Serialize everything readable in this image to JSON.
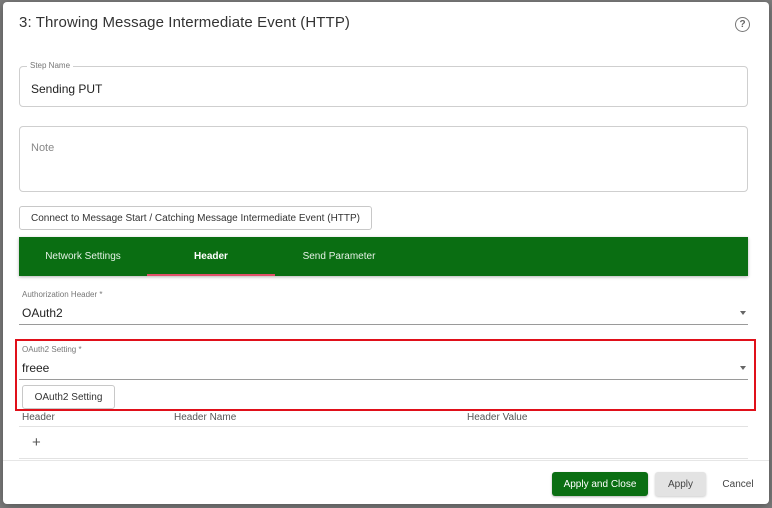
{
  "dialog": {
    "title": "3: Throwing Message Intermediate Event (HTTP)",
    "help_icon": "?"
  },
  "step_name": {
    "label": "Step Name",
    "value": "Sending PUT"
  },
  "note": {
    "placeholder": "Note"
  },
  "connect_button": {
    "label": "Connect to Message Start / Catching Message Intermediate Event (HTTP)"
  },
  "tabs": [
    {
      "label": "Network Settings",
      "active": false
    },
    {
      "label": "Header",
      "active": true
    },
    {
      "label": "Send Parameter",
      "active": false
    }
  ],
  "authorization_header": {
    "label": "Authorization Header *",
    "value": "OAuth2"
  },
  "oauth2_setting": {
    "label": "OAuth2 Setting *",
    "value": "freee",
    "button_label": "OAuth2 Setting"
  },
  "header_table": {
    "columns": [
      "Header",
      "Header Name",
      "Header Value"
    ],
    "add_icon": "+"
  },
  "footer": {
    "apply_close_label": "Apply and Close",
    "apply_label": "Apply",
    "cancel_label": "Cancel"
  },
  "colors": {
    "brand_green": "#0a6e12",
    "tab_indicator": "#e0506a",
    "highlight_red": "#e0101a"
  }
}
